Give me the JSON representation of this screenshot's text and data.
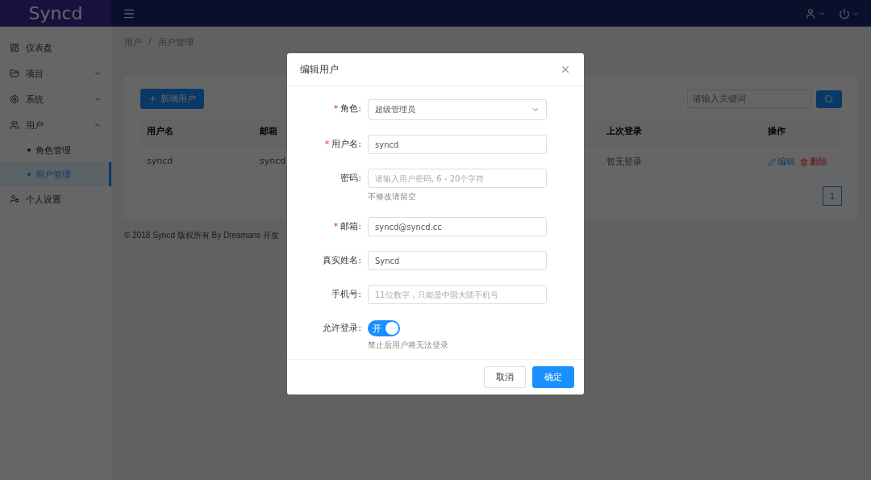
{
  "header": {
    "logo": "Syncd"
  },
  "sidebar": {
    "items": [
      {
        "label": "仪表盘",
        "expandable": false
      },
      {
        "label": "项目",
        "expandable": true,
        "expanded": false
      },
      {
        "label": "系统",
        "expandable": true,
        "expanded": false
      },
      {
        "label": "用户",
        "expandable": true,
        "expanded": true,
        "children": [
          {
            "label": "角色管理",
            "selected": false
          },
          {
            "label": "用户管理",
            "selected": true
          }
        ]
      },
      {
        "label": "个人设置",
        "expandable": false
      }
    ]
  },
  "breadcrumb": {
    "items": [
      "用户",
      "用户管理"
    ],
    "separator": "/"
  },
  "toolbar": {
    "add_button": "新增用户",
    "search_placeholder": "请输入关键词"
  },
  "table": {
    "columns": [
      "用户名",
      "邮箱",
      "上次登录",
      "操作"
    ],
    "rows": [
      {
        "cells": [
          "syncd",
          "syncd",
          "暂无登录"
        ],
        "actions": [
          "编辑",
          "删除"
        ]
      }
    ]
  },
  "pagination": [
    {
      "label": "1",
      "selected": true
    }
  ],
  "footer": "© 2018 Syncd 版权所有 By Dreamans 开发",
  "dialog": {
    "title": "编辑用户",
    "fields": [
      {
        "kind": "select",
        "label": "角色:",
        "required_mark": "*",
        "value": "超级管理员"
      },
      {
        "kind": "text",
        "label": "用户名:",
        "required_mark": "*",
        "value": "syncd"
      },
      {
        "kind": "text",
        "label": "密码:",
        "placeholder": "请输入用户密码, 6 - 20个字符",
        "hint": "不修改请留空"
      },
      {
        "kind": "text",
        "label": "邮箱:",
        "required_mark": "*",
        "value": "syncd@syncd.cc"
      },
      {
        "kind": "text",
        "label": "真实姓名:",
        "value": "Syncd"
      },
      {
        "kind": "text",
        "label": "手机号:",
        "placeholder": "11位数字，只能是中国大陆手机号"
      },
      {
        "kind": "switch",
        "label": "允许登录:",
        "on": true,
        "switch_text": "开",
        "hint": "禁止后用户将无法登录"
      }
    ],
    "buttons": [
      {
        "label": "取消",
        "primary": false
      },
      {
        "label": "确定",
        "primary": true
      }
    ]
  }
}
